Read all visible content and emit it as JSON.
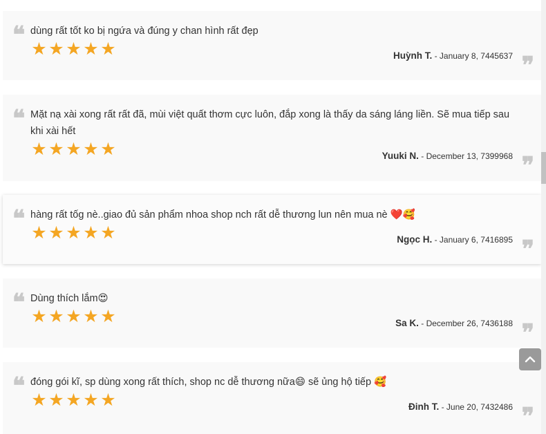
{
  "reviews": [
    {
      "text": "dùng rất tốt ko bị ngứa và đúng y chan hình rất đẹp",
      "rating": 5,
      "author": "Huỳnh T.",
      "date": "- January 8, 7445637"
    },
    {
      "text": "Mặt nạ xài xong rất rất đã, mùi việt quất thơm cực luôn, đắp xong là thấy da sáng láng liền. Sẽ mua tiếp sau khi xài hết",
      "rating": 5,
      "author": "Yuuki N.",
      "date": "- December 13, 7399968"
    },
    {
      "text": "hàng rất tốg nè..giao đủ sản phẩm nhoa shop nch rất dễ thương lun nên mua nè ❤️🥰",
      "rating": 5,
      "author": "Ngọc H.",
      "date": "- January 6, 7416895"
    },
    {
      "text": "Dùng thích lắm😍",
      "rating": 5,
      "author": "Sa K.",
      "date": "- December 26, 7436188"
    },
    {
      "text": "đóng gói kĩ, sp dùng xong rất thích, shop nc dễ thương nữa😄 sẽ ủng hộ tiếp 🥰",
      "rating": 5,
      "author": "Đinh T.",
      "date": "- June 20, 7432486"
    }
  ],
  "icons": {
    "quote_open": "❝",
    "quote_close": "❞",
    "star": "★",
    "back_to_top": "chevron-up-icon"
  },
  "colors": {
    "star": "#f4a623",
    "card_bg": "#f9f9f9",
    "quote": "#c8c8c8",
    "back_to_top_bg": "#9a9a9a"
  }
}
